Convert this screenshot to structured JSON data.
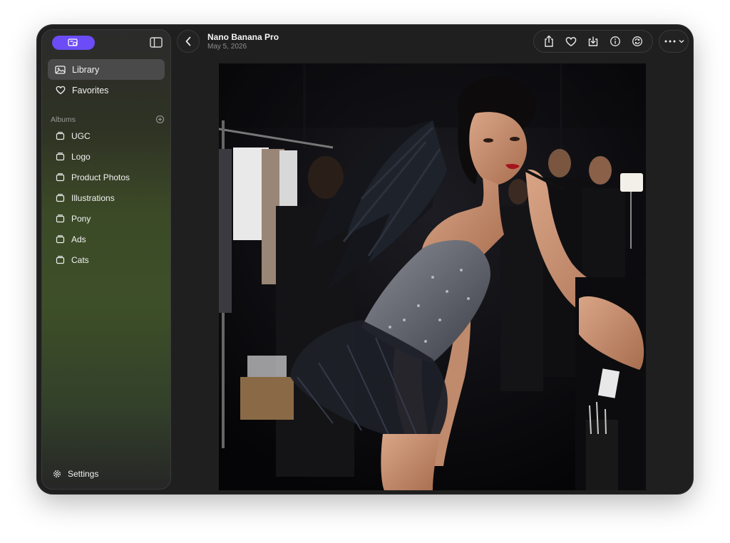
{
  "header": {
    "title": "Nano Banana Pro",
    "date": "May 5, 2026"
  },
  "sidebar": {
    "brand_icon": "gallery-app-icon",
    "nav": [
      {
        "label": "Library",
        "icon": "photo-library-icon",
        "active": true
      },
      {
        "label": "Favorites",
        "icon": "heart-icon",
        "active": false
      }
    ],
    "albums_label": "Albums",
    "albums": [
      {
        "label": "UGC",
        "icon": "album-icon"
      },
      {
        "label": "Logo",
        "icon": "album-icon"
      },
      {
        "label": "Product Photos",
        "icon": "album-icon"
      },
      {
        "label": "Illustrations",
        "icon": "album-icon"
      },
      {
        "label": "Pony",
        "icon": "album-icon"
      },
      {
        "label": "Ads",
        "icon": "album-icon"
      },
      {
        "label": "Cats",
        "icon": "album-icon"
      }
    ],
    "settings_label": "Settings"
  },
  "toolbar": {
    "buttons": [
      "share-icon",
      "heart-icon",
      "download-icon",
      "info-icon",
      "refresh-icon"
    ]
  },
  "colors": {
    "accent": "#6b4cf6",
    "window_bg": "#1f1f1f",
    "active_item": "#4a4a4a"
  }
}
